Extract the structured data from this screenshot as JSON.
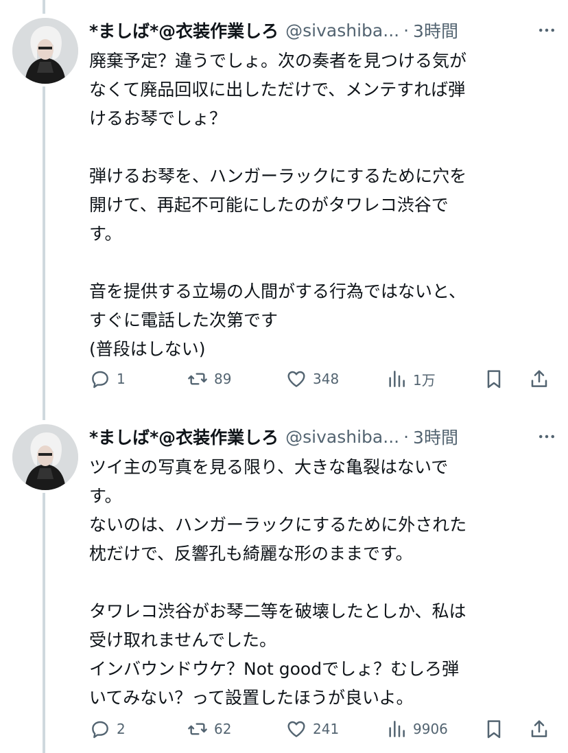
{
  "tweets": [
    {
      "user": {
        "name": "*ましば*@衣装作業しろ",
        "handle": "@sivashiba..."
      },
      "separator": "·",
      "time": "3時間",
      "text": "廃棄予定？違うでしょ。次の奏者を見つける気が\nなくて廃品回収に出しただけで、メンテすれば弾\nけるお琴でしょ？\n\n弾けるお琴を、ハンガーラックにするために穴を\n開けて、再起不可能にしたのがタワレコ渋谷で\nす。\n\n音を提供する立場の人間がする行為ではないと、\nすぐに電話した次第です\n(普段はしない)",
      "stats": {
        "replies": "1",
        "retweets": "89",
        "likes": "348",
        "views": "1万"
      }
    },
    {
      "user": {
        "name": "*ましば*@衣装作業しろ",
        "handle": "@sivashiba..."
      },
      "separator": "·",
      "time": "3時間",
      "text": "ツイ主の写真を見る限り、大きな亀裂はないで\nす。\nないのは、ハンガーラックにするために外された\n枕だけで、反響孔も綺麗な形のままです。\n\nタワレコ渋谷がお琴二等を破壊したとしか、私は\n受け取れませんでした。\nインバウンドウケ？Not goodでしょ？むしろ弾\nいてみない？って設置したほうが良いよ。",
      "stats": {
        "replies": "2",
        "retweets": "62",
        "likes": "241",
        "views": "9906"
      }
    }
  ],
  "icons": {
    "avatar": "avatar-photo",
    "more": "more-icon",
    "reply": "reply-icon",
    "retweet": "retweet-icon",
    "like": "heart-icon",
    "views": "views-icon",
    "bookmark": "bookmark-icon",
    "share": "share-icon"
  },
  "colors": {
    "text": "#0f1419",
    "secondary": "#536471",
    "thread_line": "#cfd9de"
  }
}
